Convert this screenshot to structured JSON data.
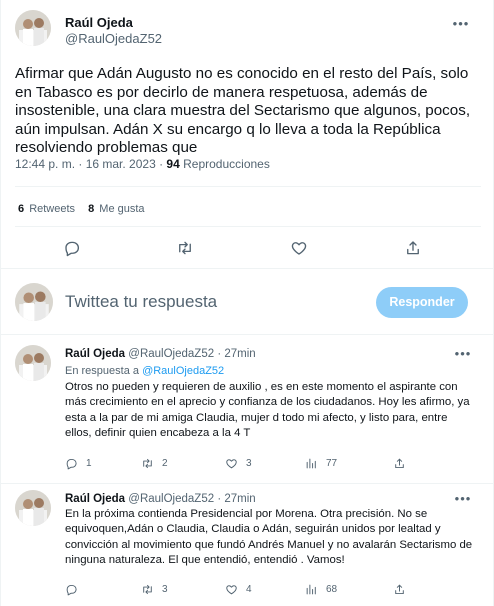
{
  "main_tweet": {
    "author_name": "Raúl Ojeda",
    "author_handle": "@RaulOjedaZ52",
    "text": "Afirmar que Adán Augusto no es conocido en el resto del País, solo en Tabasco es por decirlo de manera respetuosa, además de insostenible, una clara muestra del Sectarismo que algunos, pocos, aún impulsan. Adán X su encargo q lo lleva a toda la República resolviendo problemas que",
    "time": "12:44 p. m. · 16 mar. 2023 ·",
    "views_count": "94",
    "views_label": "Reproducciones",
    "retweets_count": "6",
    "retweets_label": "Retweets",
    "likes_count": "8",
    "likes_label": "Me gusta",
    "icons": [
      "reply-icon",
      "retweet-icon",
      "like-icon",
      "share-icon"
    ]
  },
  "composer": {
    "placeholder": "Twittea tu respuesta",
    "button_label": "Responder",
    "button_color": "#8ecdf8"
  },
  "replies": [
    {
      "author_name": "Raúl Ojeda",
      "author_handle": "@RaulOjedaZ52",
      "time": "· 27min",
      "replying_prefix": "En respuesta a",
      "replying_to": "@RaulOjedaZ52",
      "text": "Otros no pueden y requieren de auxilio , es en este momento el aspirante con más crecimiento en el aprecio y confianza de los ciudadanos. Hoy les afirmo, ya esta a la par de mi amiga Claudia, mujer d todo mi afecto, y listo para, entre ellos, definir quien encabeza a la 4 T",
      "reply_count": "1",
      "retweet_count": "2",
      "like_count": "3",
      "views_count": "77"
    },
    {
      "author_name": "Raúl Ojeda",
      "author_handle": "@RaulOjedaZ52",
      "time": "· 27min",
      "text": "En la próxima contienda Presidencial por Morena. Otra precisión. No se equivoquen,Adán o Claudia, Claudia o Adán, seguirán unidos por lealtad y convicción al movimiento que fundó Andrés Manuel y no avalarán Sectarismo de ninguna naturaleza. El que entendió, entendió . Vamos!",
      "reply_count": "",
      "retweet_count": "3",
      "like_count": "4",
      "views_count": "68"
    }
  ],
  "colors": {
    "accent": "#1d9bf0",
    "muted_text": "#536471",
    "divider": "#eff3f4"
  }
}
